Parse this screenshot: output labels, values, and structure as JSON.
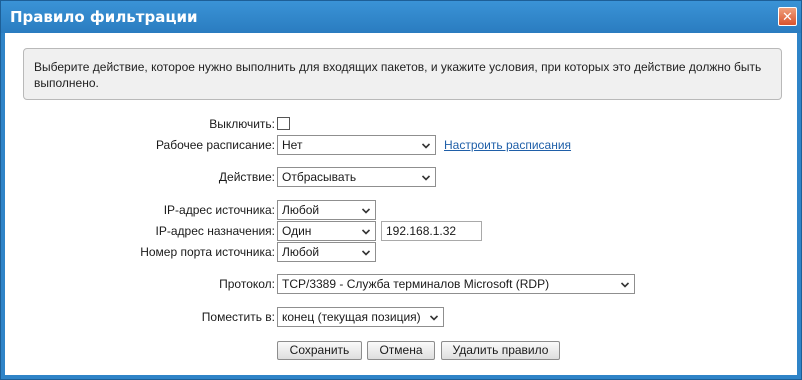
{
  "window": {
    "title": "Правило фильтрации",
    "close_glyph": "✕"
  },
  "info_text": "Выберите действие, которое нужно выполнить для входящих пакетов, и укажите условия, при которых это действие должно быть выполнено.",
  "form": {
    "disable_label": "Выключить:",
    "disable_checked": false,
    "schedule_label": "Рабочее расписание:",
    "schedule_value": "Нет",
    "schedule_link": "Настроить расписания",
    "action_label": "Действие:",
    "action_value": "Отбрасывать",
    "src_ip_label": "IP-адрес источника:",
    "src_ip_value": "Любой",
    "dst_ip_label": "IP-адрес назначения:",
    "dst_ip_value": "Один",
    "dst_ip_address": "192.168.1.32",
    "src_port_label": "Номер порта источника:",
    "src_port_value": "Любой",
    "protocol_label": "Протокол:",
    "protocol_value": "TCP/3389 - Служба терминалов Microsoft (RDP)",
    "position_label": "Поместить в:",
    "position_value": "конец (текущая позиция)"
  },
  "buttons": {
    "save": "Сохранить",
    "cancel": "Отмена",
    "delete": "Удалить правило"
  },
  "icons": {
    "dropdown": "chevron-down-icon",
    "close": "close-icon"
  }
}
